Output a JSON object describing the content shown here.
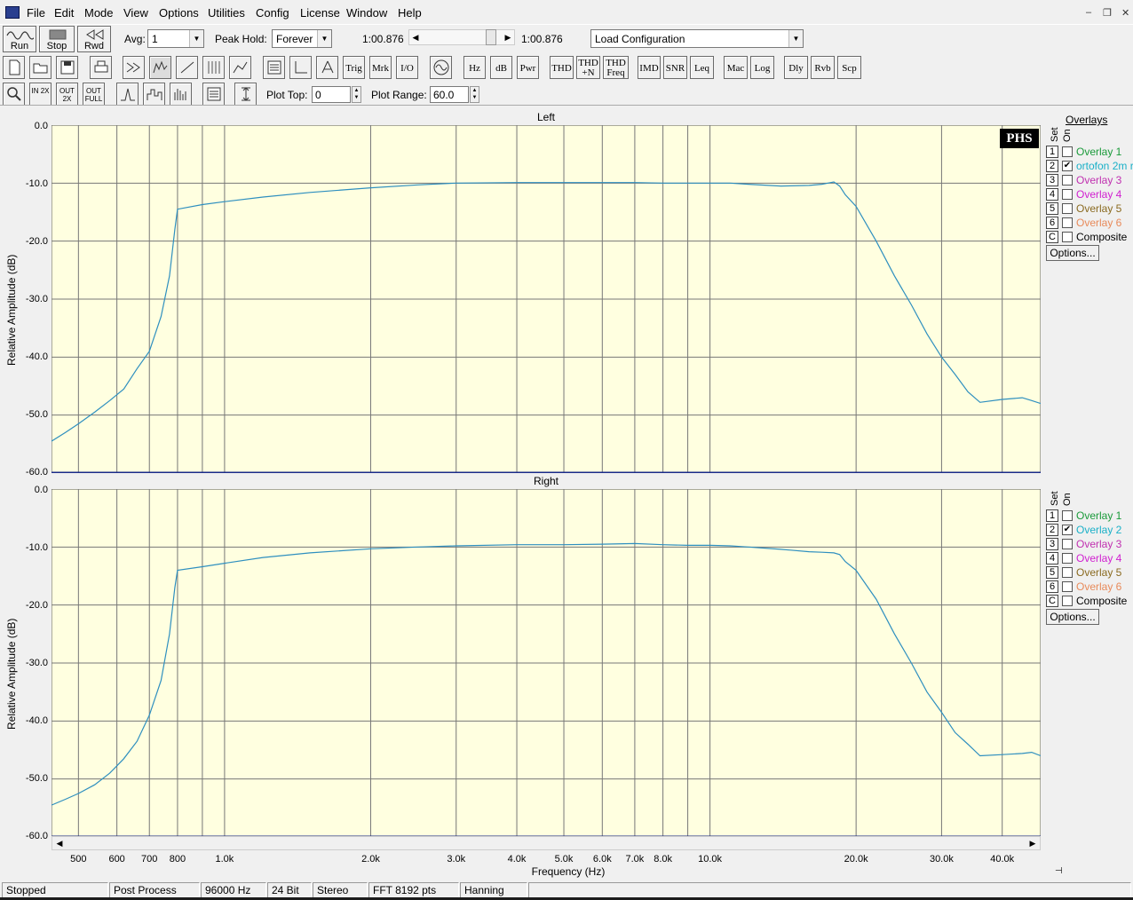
{
  "menubar": {
    "items": [
      "File",
      "Edit",
      "Mode",
      "View",
      "Options",
      "Utilities",
      "Config",
      "License",
      "Window",
      "Help"
    ]
  },
  "toolbar1": {
    "run_label": "Run",
    "stop_label": "Stop",
    "rwd_label": "Rwd",
    "avg_label": "Avg:",
    "avg_value": "1",
    "peakhold_label": "Peak Hold:",
    "peakhold_value": "Forever",
    "time_left": "1:00.876",
    "time_right": "1:00.876",
    "load_config": "Load Configuration"
  },
  "toolbar2": {
    "text_buttons": [
      "Trig",
      "Mrk",
      "I/O",
      "Hz",
      "dB",
      "Pwr",
      "THD",
      "THD +N",
      "THD Freq",
      "IMD",
      "SNR",
      "Leq",
      "Mac",
      "Log",
      "Dly",
      "Rvb",
      "Scp"
    ]
  },
  "toolbar3": {
    "zoom_labels": [
      "IN 2X",
      "OUT 2X",
      "OUT FULL"
    ],
    "plot_top_label": "Plot Top:",
    "plot_top_value": "0",
    "plot_range_label": "Plot Range:",
    "plot_range_value": "60.0"
  },
  "plots": {
    "left_title": "Left",
    "right_title": "Right",
    "ylabel": "Relative Amplitude (dB)",
    "xlabel": "Frequency (Hz)",
    "yticks": [
      "0.0",
      "-10.0",
      "-20.0",
      "-30.0",
      "-40.0",
      "-50.0",
      "-60.0"
    ],
    "xticks": [
      "500",
      "600",
      "700",
      "800",
      "1.0k",
      "2.0k",
      "3.0k",
      "4.0k",
      "5.0k",
      "6.0k",
      "7.0k",
      "8.0k",
      "10.0k",
      "20.0k",
      "30.0k",
      "40.0k"
    ],
    "logo": "PHS",
    "line_color": "#2e8fbf",
    "bg_color": "#ffffe0"
  },
  "overlays": {
    "title": "Overlays",
    "set_label": "Set",
    "on_label": "On",
    "options_label": "Options...",
    "left": [
      {
        "set": "1",
        "name": "Overlay 1",
        "on": false,
        "color": "#1a9a3a"
      },
      {
        "set": "2",
        "name": "ortofon 2m r",
        "on": true,
        "color": "#1ab0c8"
      },
      {
        "set": "3",
        "name": "Overlay 3",
        "on": false,
        "color": "#c030b0"
      },
      {
        "set": "4",
        "name": "Overlay 4",
        "on": false,
        "color": "#d020d0"
      },
      {
        "set": "5",
        "name": "Overlay 5",
        "on": false,
        "color": "#8a6a20"
      },
      {
        "set": "6",
        "name": "Overlay 6",
        "on": false,
        "color": "#e88a5a"
      },
      {
        "set": "C",
        "name": "Composite",
        "on": false,
        "color": "#000000"
      }
    ],
    "right": [
      {
        "set": "1",
        "name": "Overlay 1",
        "on": false,
        "color": "#1a9a3a"
      },
      {
        "set": "2",
        "name": "Overlay 2",
        "on": true,
        "color": "#1ab0c8"
      },
      {
        "set": "3",
        "name": "Overlay 3",
        "on": false,
        "color": "#c030b0"
      },
      {
        "set": "4",
        "name": "Overlay 4",
        "on": false,
        "color": "#d020d0"
      },
      {
        "set": "5",
        "name": "Overlay 5",
        "on": false,
        "color": "#8a6a20"
      },
      {
        "set": "6",
        "name": "Overlay 6",
        "on": false,
        "color": "#e88a5a"
      },
      {
        "set": "C",
        "name": "Composite",
        "on": false,
        "color": "#000000"
      }
    ]
  },
  "status": {
    "cells": [
      "Stopped",
      "Post Process",
      "96000 Hz",
      "24 Bit",
      "Stereo",
      "FFT 8192 pts",
      "Hanning"
    ]
  },
  "chart_data": [
    {
      "type": "line",
      "title": "Left",
      "xlabel": "Frequency (Hz)",
      "ylabel": "Relative Amplitude (dB)",
      "xscale": "log",
      "ylim": [
        -60,
        0
      ],
      "xlim": [
        440,
        48000
      ],
      "grid": true,
      "x": [
        440,
        470,
        500,
        540,
        580,
        620,
        660,
        700,
        740,
        770,
        790,
        800,
        900,
        1000,
        1200,
        1500,
        2000,
        2500,
        3000,
        4000,
        5000,
        6000,
        7000,
        8000,
        9000,
        10000,
        11000,
        12000,
        14000,
        16000,
        17000,
        17500,
        18000,
        18500,
        19000,
        20000,
        22000,
        24000,
        26000,
        28000,
        30000,
        32000,
        34000,
        36000,
        40000,
        44000,
        46000,
        48000
      ],
      "y": [
        -54.5,
        -53,
        -51.5,
        -49.5,
        -47.5,
        -45.5,
        -42,
        -39,
        -33,
        -26,
        -18,
        -14.5,
        -13.7,
        -13.2,
        -12.4,
        -11.6,
        -10.8,
        -10.3,
        -10.0,
        -9.9,
        -9.9,
        -9.9,
        -9.9,
        -10.0,
        -10.0,
        -10.0,
        -10.0,
        -10.2,
        -10.5,
        -10.4,
        -10.2,
        -10.0,
        -9.8,
        -10.5,
        -12,
        -14,
        -20,
        -26,
        -31,
        -36,
        -40,
        -43,
        -46,
        -47.8,
        -47.3,
        -47,
        -47.5,
        -48
      ]
    },
    {
      "type": "line",
      "title": "Right",
      "xlabel": "Frequency (Hz)",
      "ylabel": "Relative Amplitude (dB)",
      "xscale": "log",
      "ylim": [
        -60,
        0
      ],
      "xlim": [
        440,
        48000
      ],
      "grid": true,
      "x": [
        440,
        470,
        500,
        540,
        580,
        620,
        660,
        700,
        740,
        770,
        790,
        800,
        900,
        1000,
        1200,
        1500,
        2000,
        2500,
        3000,
        4000,
        5000,
        6000,
        7000,
        8000,
        9000,
        10000,
        11000,
        12000,
        14000,
        16000,
        17000,
        18000,
        18500,
        19000,
        20000,
        22000,
        24000,
        26000,
        28000,
        30000,
        32000,
        34000,
        36000,
        40000,
        44000,
        46000,
        48000
      ],
      "y": [
        -54.5,
        -53.5,
        -52.5,
        -51,
        -49,
        -46.5,
        -43.5,
        -39,
        -33,
        -25,
        -17,
        -14,
        -13.4,
        -12.8,
        -11.8,
        -11.0,
        -10.3,
        -10.0,
        -9.8,
        -9.6,
        -9.6,
        -9.5,
        -9.4,
        -9.6,
        -9.7,
        -9.7,
        -9.8,
        -10.0,
        -10.4,
        -10.8,
        -10.9,
        -11.0,
        -11.3,
        -12.5,
        -14,
        -19,
        -25,
        -30,
        -35,
        -38.5,
        -42,
        -44,
        -46,
        -45.8,
        -45.6,
        -45.4,
        -46
      ]
    }
  ]
}
